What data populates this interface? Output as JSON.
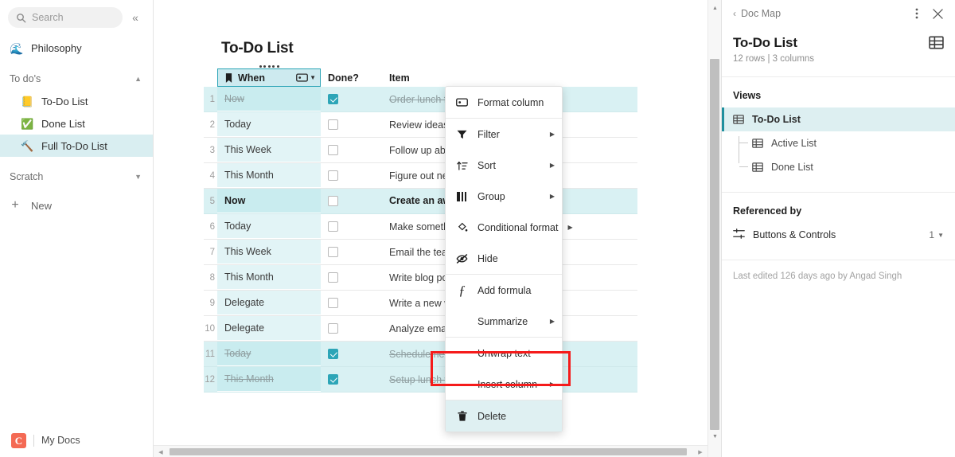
{
  "sidebar": {
    "search": {
      "placeholder": "Search",
      "icon": "search-icon"
    },
    "collapse_icon": "«",
    "top_item": {
      "label": "Philosophy",
      "emoji": "🌊"
    },
    "sections": [
      {
        "label": "To do's",
        "expanded": true,
        "items": [
          {
            "label": "To-Do List",
            "emoji": "📒",
            "active": false
          },
          {
            "label": "Done List",
            "emoji": "✅",
            "active": false
          },
          {
            "label": "Full To-Do List",
            "emoji": "🔨",
            "active": true
          }
        ]
      },
      {
        "label": "Scratch",
        "expanded": false,
        "items": []
      }
    ],
    "new_label": "New",
    "footer": {
      "logo": "C",
      "label": "My Docs"
    }
  },
  "canvas": {
    "doc_title": "To-Do List",
    "table": {
      "columns": [
        {
          "label": "When",
          "icon": "bookmark-icon",
          "selected": true,
          "type_icon": "select-list-icon"
        },
        {
          "label": "Done?",
          "icon": null,
          "selected": false
        },
        {
          "label": "Item",
          "icon": null,
          "selected": false
        }
      ],
      "rows": [
        {
          "n": "1",
          "when": "Now",
          "done": true,
          "item": "Order lunch for the team",
          "highlight": true,
          "struck": true
        },
        {
          "n": "2",
          "when": "Today",
          "done": false,
          "item": "Review ideas for new email",
          "highlight": false,
          "struck": false
        },
        {
          "n": "3",
          "when": "This Week",
          "done": false,
          "item": "Follow up about doc organization",
          "highlight": false,
          "struck": false
        },
        {
          "n": "4",
          "when": "This Month",
          "done": false,
          "item": "Figure out new approach to onboarding",
          "highlight": false,
          "struck": false
        },
        {
          "n": "5",
          "when": "Now",
          "done": false,
          "item": "Create an awesome new to do list 😀",
          "highlight": true,
          "struck": false
        },
        {
          "n": "6",
          "when": "Today",
          "done": false,
          "item": "Make something awesome",
          "highlight": false,
          "struck": false
        },
        {
          "n": "7",
          "when": "This Week",
          "done": false,
          "item": "Email the team about upcoming offsite",
          "highlight": false,
          "struck": false
        },
        {
          "n": "8",
          "when": "This Month",
          "done": false,
          "item": "Write blog post on 'to-do' lists",
          "highlight": false,
          "struck": false
        },
        {
          "n": "9",
          "when": "Delegate",
          "done": false,
          "item": "Write a new welcome email",
          "highlight": false,
          "struck": false
        },
        {
          "n": "10",
          "when": "Delegate",
          "done": false,
          "item": "Analyze email campaign data",
          "highlight": false,
          "struck": false
        },
        {
          "n": "11",
          "when": "Today",
          "done": true,
          "item": "Schedule next team offsite",
          "highlight": true,
          "struck": true
        },
        {
          "n": "12",
          "when": "This Month",
          "done": true,
          "item": "Setup lunch with Katie",
          "highlight": true,
          "struck": true
        }
      ]
    },
    "context_menu": {
      "items": [
        {
          "label": "Format column",
          "icon": "format-column-icon",
          "submenu": false,
          "highlighted": false
        },
        {
          "sep": true
        },
        {
          "label": "Filter",
          "icon": "filter-icon",
          "submenu": true,
          "highlighted": false
        },
        {
          "label": "Sort",
          "icon": "sort-icon",
          "submenu": true,
          "highlighted": false
        },
        {
          "label": "Group",
          "icon": "group-icon",
          "submenu": true,
          "highlighted": false
        },
        {
          "label": "Conditional format",
          "icon": "paint-bucket-icon",
          "submenu": true,
          "highlighted": false
        },
        {
          "label": "Hide",
          "icon": "eye-off-icon",
          "submenu": false,
          "highlighted": false
        },
        {
          "sep": true
        },
        {
          "label": "Add formula",
          "icon": "formula-icon",
          "submenu": false,
          "highlighted": false
        },
        {
          "label": "Summarize",
          "icon": null,
          "submenu": true,
          "highlighted": false
        },
        {
          "sep": true
        },
        {
          "label": "Unwrap text",
          "icon": null,
          "submenu": false,
          "highlighted": false
        },
        {
          "label": "Insert column",
          "icon": null,
          "submenu": true,
          "highlighted": false
        },
        {
          "sep": true
        },
        {
          "label": "Delete",
          "icon": "trash-icon",
          "submenu": false,
          "highlighted": true
        }
      ]
    },
    "annotation": {
      "color": "#f51b1b",
      "target": "Delete"
    }
  },
  "right_panel": {
    "back_label": "Doc Map",
    "more_icon": "kebab-menu-icon",
    "close_icon": "close-icon",
    "title": "To-Do List",
    "subtitle": "12 rows | 3 columns",
    "table_icon": "table-icon",
    "views_header": "Views",
    "views": [
      {
        "label": "To-Do List",
        "active": true,
        "child": false
      },
      {
        "label": "Active List",
        "active": false,
        "child": true
      },
      {
        "label": "Done List",
        "active": false,
        "child": true
      }
    ],
    "referenced_header": "Referenced by",
    "referenced": {
      "label": "Buttons & Controls",
      "count": "1",
      "icon": "controls-icon"
    },
    "footer": "Last edited 126 days ago by Angad Singh"
  },
  "colors": {
    "accent": "#2da5b7",
    "row_highlight": "#d9f1f3",
    "when_cell": "#e2f4f6",
    "sidebar_active": "#d9eef1",
    "annotation_red": "#f51b1b",
    "coda_logo": "#f46a54"
  }
}
